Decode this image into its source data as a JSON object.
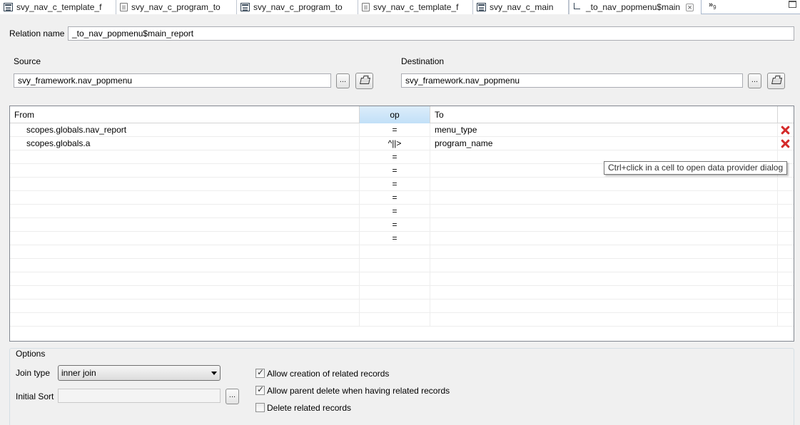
{
  "tabs": [
    {
      "label": "svy_nav_c_template_f",
      "icon": "form-icon"
    },
    {
      "label": "svy_nav_c_program_to",
      "icon": "file-icon"
    },
    {
      "label": "svy_nav_c_program_to",
      "icon": "form-icon"
    },
    {
      "label": "svy_nav_c_template_f",
      "icon": "file-icon"
    },
    {
      "label": "svy_nav_c_main",
      "icon": "form-icon"
    },
    {
      "label": "_to_nav_popmenu$main",
      "icon": "relation-icon",
      "active": true
    }
  ],
  "tab_overflow": {
    "symbol": "»",
    "count": "9"
  },
  "relation": {
    "label": "Relation name",
    "value": "_to_nav_popmenu$main_report"
  },
  "source": {
    "label": "Source",
    "value": "svy_framework.nav_popmenu",
    "browse_label": "..."
  },
  "destination": {
    "label": "Destination",
    "value": "svy_framework.nav_popmenu",
    "browse_label": "..."
  },
  "grid": {
    "headers": {
      "from": "From",
      "op": "op",
      "to": "To"
    },
    "rows": [
      {
        "from": "scopes.globals.nav_report",
        "op": "=",
        "to": "menu_type",
        "deletable": true
      },
      {
        "from": "scopes.globals.a",
        "op": "^||>",
        "to": "program_name",
        "deletable": true
      },
      {
        "from": "",
        "op": "=",
        "to": ""
      },
      {
        "from": "",
        "op": "=",
        "to": ""
      },
      {
        "from": "",
        "op": "=",
        "to": ""
      },
      {
        "from": "",
        "op": "=",
        "to": ""
      },
      {
        "from": "",
        "op": "=",
        "to": ""
      },
      {
        "from": "",
        "op": "=",
        "to": ""
      },
      {
        "from": "",
        "op": "=",
        "to": ""
      },
      {
        "from": "",
        "op": "",
        "to": ""
      },
      {
        "from": "",
        "op": "",
        "to": ""
      },
      {
        "from": "",
        "op": "",
        "to": ""
      },
      {
        "from": "",
        "op": "",
        "to": ""
      },
      {
        "from": "",
        "op": "",
        "to": ""
      },
      {
        "from": "",
        "op": "",
        "to": ""
      }
    ]
  },
  "tooltip": "Ctrl+click in a cell to open data provider dialog",
  "options": {
    "title": "Options",
    "join_type": {
      "label": "Join type",
      "value": "inner join"
    },
    "initial_sort": {
      "label": "Initial Sort",
      "value": "",
      "browse_label": "..."
    },
    "checkboxes": [
      {
        "label": "Allow creation of related records",
        "checked": true
      },
      {
        "label": "Allow parent delete when having related records",
        "checked": true
      },
      {
        "label": "Delete related records",
        "checked": false
      }
    ]
  },
  "colors": {
    "op_header": "#c2e0f8",
    "delete": "#d42a2a"
  }
}
